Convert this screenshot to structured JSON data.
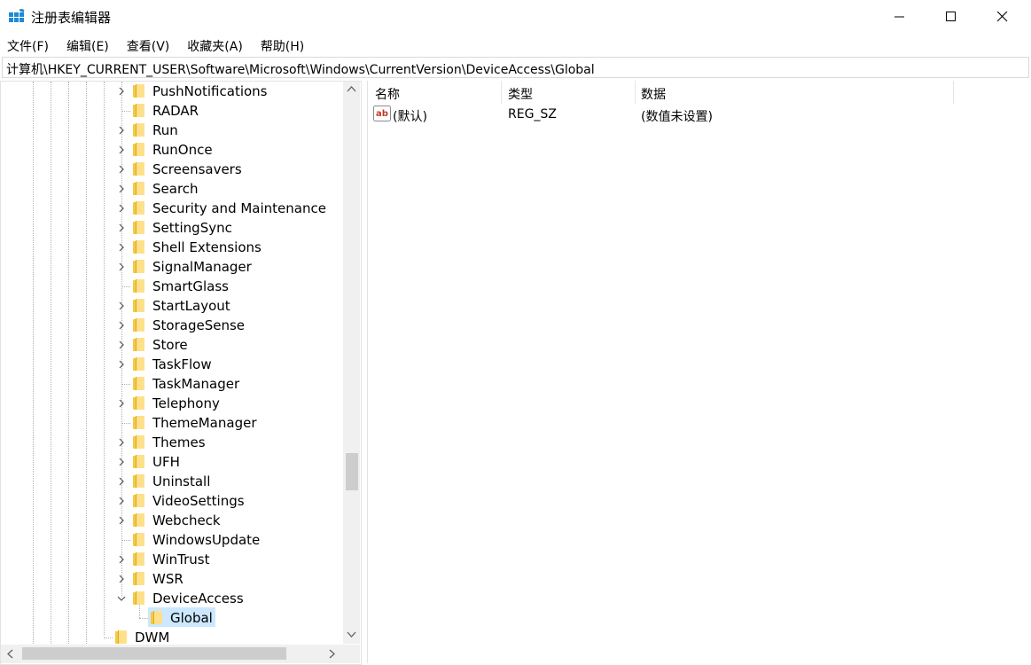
{
  "window": {
    "title": "注册表编辑器",
    "controls": {
      "minimize": "—",
      "maximize": "□",
      "close": "✕"
    }
  },
  "menu": [
    "文件(F)",
    "编辑(E)",
    "查看(V)",
    "收藏夹(A)",
    "帮助(H)"
  ],
  "address": "计算机\\HKEY_CURRENT_USER\\Software\\Microsoft\\Windows\\CurrentVersion\\DeviceAccess\\Global",
  "tree": {
    "items": [
      {
        "label": "PushNotifications",
        "expandable": true
      },
      {
        "label": "RADAR",
        "expandable": false
      },
      {
        "label": "Run",
        "expandable": true
      },
      {
        "label": "RunOnce",
        "expandable": true
      },
      {
        "label": "Screensavers",
        "expandable": true
      },
      {
        "label": "Search",
        "expandable": true
      },
      {
        "label": "Security and Maintenance",
        "expandable": true
      },
      {
        "label": "SettingSync",
        "expandable": true
      },
      {
        "label": "Shell Extensions",
        "expandable": true
      },
      {
        "label": "SignalManager",
        "expandable": true
      },
      {
        "label": "SmartGlass",
        "expandable": false
      },
      {
        "label": "StartLayout",
        "expandable": true
      },
      {
        "label": "StorageSense",
        "expandable": true
      },
      {
        "label": "Store",
        "expandable": true
      },
      {
        "label": "TaskFlow",
        "expandable": true
      },
      {
        "label": "TaskManager",
        "expandable": false
      },
      {
        "label": "Telephony",
        "expandable": true
      },
      {
        "label": "ThemeManager",
        "expandable": false
      },
      {
        "label": "Themes",
        "expandable": true
      },
      {
        "label": "UFH",
        "expandable": true
      },
      {
        "label": "Uninstall",
        "expandable": true
      },
      {
        "label": "VideoSettings",
        "expandable": true
      },
      {
        "label": "Webcheck",
        "expandable": true
      },
      {
        "label": "WindowsUpdate",
        "expandable": false
      },
      {
        "label": "WinTrust",
        "expandable": true
      },
      {
        "label": "WSR",
        "expandable": true
      },
      {
        "label": "DeviceAccess",
        "expandable": true,
        "expanded": true
      },
      {
        "label": "Global",
        "expandable": false,
        "selected": true
      },
      {
        "label": "DWM",
        "expandable": false
      }
    ]
  },
  "values_pane": {
    "columns": [
      "名称",
      "类型",
      "数据"
    ],
    "rows": [
      {
        "name": "(默认)",
        "type": "REG_SZ",
        "data": "(数值未设置)",
        "icon": "ab-string-icon"
      }
    ]
  },
  "colors": {
    "selection": "#cce8ff",
    "folder": "#f5c842",
    "accent": "#0078d7"
  }
}
